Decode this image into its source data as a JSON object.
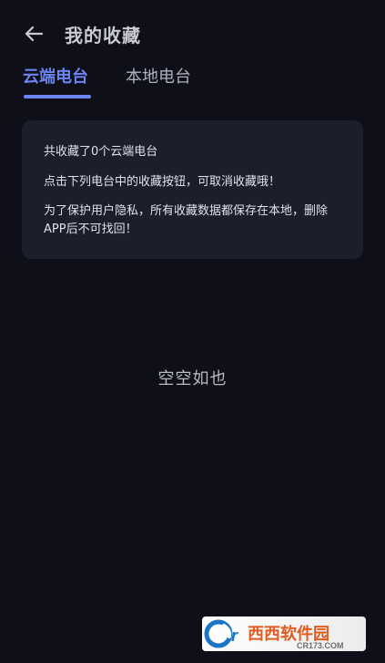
{
  "header": {
    "back_icon": "arrow-left-icon",
    "title": "我的收藏"
  },
  "tabs": [
    {
      "label": "云端电台",
      "active": true
    },
    {
      "label": "本地电台",
      "active": false
    }
  ],
  "info_card": {
    "lines": [
      "共收藏了0个云端电台",
      "点击下列电台中的收藏按钮，可取消收藏哦！",
      "为了保护用户隐私，所有收藏数据都保存在本地，删除APP后不可找回！"
    ]
  },
  "empty_state": {
    "text": "空空如也"
  },
  "watermark": {
    "text": "西西软件园",
    "subtext": "CR173.COM",
    "icon": "cr-logo-icon"
  },
  "colors": {
    "background": "#0e0f19",
    "card": "#1d1e2b",
    "accent": "#6b84f0",
    "text": "#e0e1e9",
    "muted": "#aeb0bd"
  }
}
